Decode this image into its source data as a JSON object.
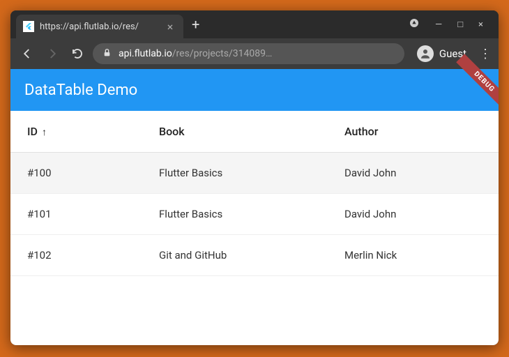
{
  "window": {
    "tab_title": "https://api.flutlab.io/res/",
    "minimize": "—",
    "maximize": "□",
    "close": "×"
  },
  "toolbar": {
    "url_host": "api.flutlab.io",
    "url_path": "/res/projects/314089…",
    "guest_label": "Guest"
  },
  "app": {
    "title": "DataTable Demo",
    "debug_label": "DEBUG"
  },
  "table": {
    "columns": {
      "id": "ID",
      "book": "Book",
      "author": "Author"
    },
    "rows": [
      {
        "id": "#100",
        "book": "Flutter Basics",
        "author": "David John"
      },
      {
        "id": "#101",
        "book": "Flutter Basics",
        "author": "David John"
      },
      {
        "id": "#102",
        "book": "Git and GitHub",
        "author": "Merlin Nick"
      }
    ]
  }
}
